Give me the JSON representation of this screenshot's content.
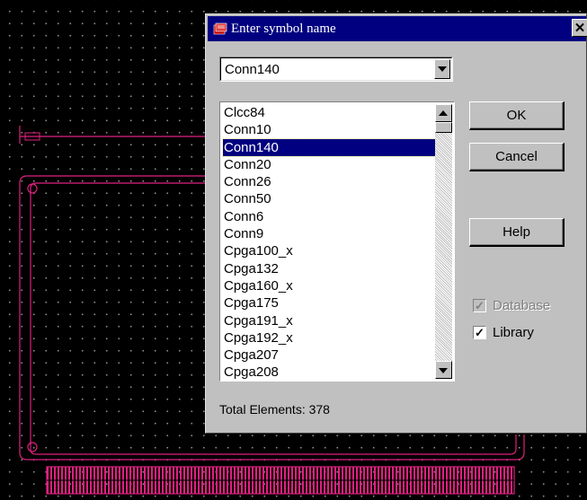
{
  "dialog": {
    "title": "Enter symbol name",
    "close_label": "✕",
    "combo_value": "Conn140",
    "list": [
      {
        "label": "Clcc84",
        "selected": false
      },
      {
        "label": "Conn10",
        "selected": false
      },
      {
        "label": "Conn140",
        "selected": true
      },
      {
        "label": "Conn20",
        "selected": false
      },
      {
        "label": "Conn26",
        "selected": false
      },
      {
        "label": "Conn50",
        "selected": false
      },
      {
        "label": "Conn6",
        "selected": false
      },
      {
        "label": "Conn9",
        "selected": false
      },
      {
        "label": "Cpga100_x",
        "selected": false
      },
      {
        "label": "Cpga132",
        "selected": false
      },
      {
        "label": "Cpga160_x",
        "selected": false
      },
      {
        "label": "Cpga175",
        "selected": false
      },
      {
        "label": "Cpga191_x",
        "selected": false
      },
      {
        "label": "Cpga192_x",
        "selected": false
      },
      {
        "label": "Cpga207",
        "selected": false
      },
      {
        "label": "Cpga208",
        "selected": false
      }
    ],
    "buttons": {
      "ok": "OK",
      "cancel": "Cancel",
      "help": "Help"
    },
    "checkboxes": {
      "database": {
        "label": "Database",
        "checked": true,
        "enabled": false
      },
      "library": {
        "label": "Library",
        "checked": true,
        "enabled": true
      }
    },
    "total_label": "Total Elements: 378"
  },
  "colors": {
    "pcb_outline": "#e0207f",
    "title_bar": "#000080",
    "dialog_bg": "#c0c0c0"
  },
  "icons": {
    "title": "app-icon",
    "close": "close-icon"
  }
}
